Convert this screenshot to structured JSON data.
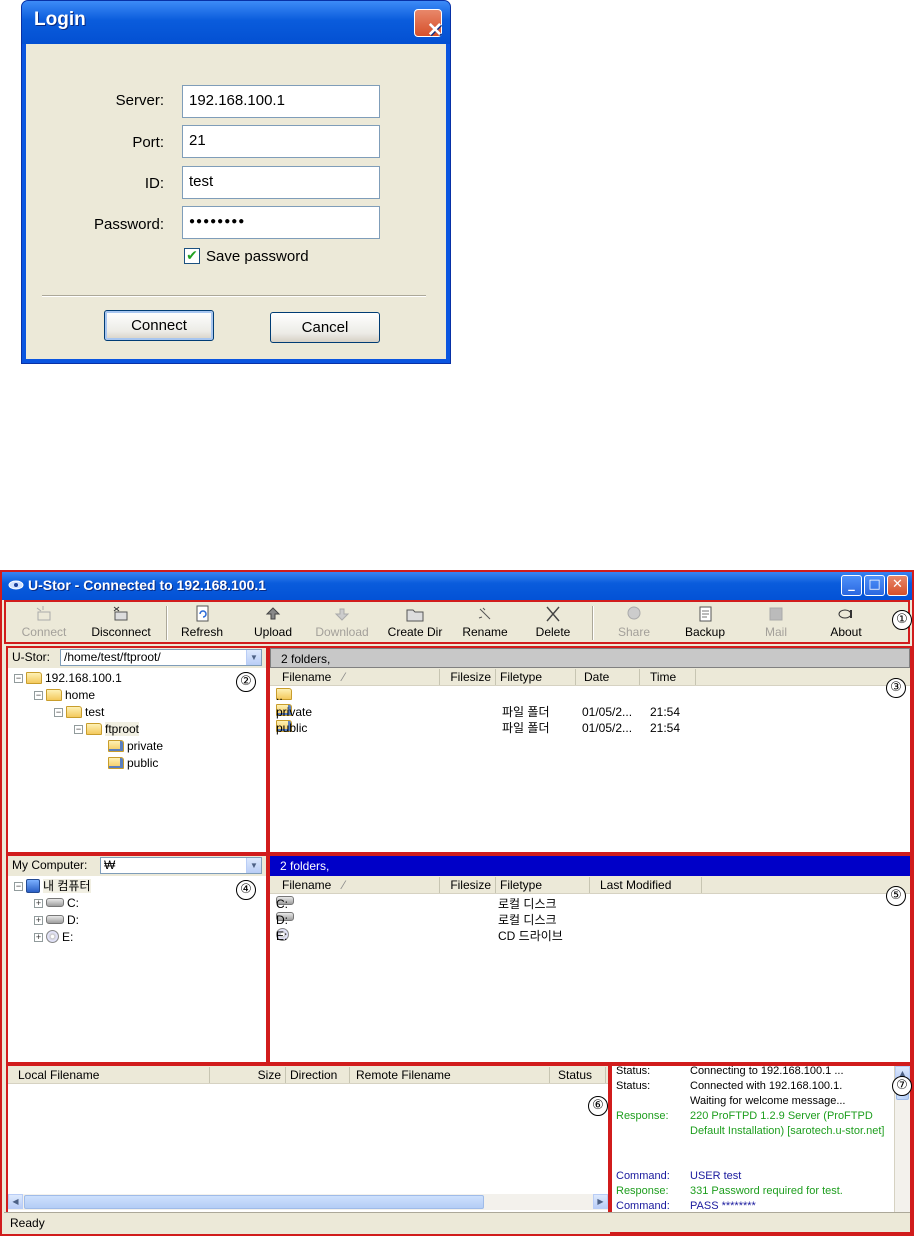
{
  "login": {
    "title": "Login",
    "close_glyph": "✕",
    "fields": [
      {
        "label": "Server:",
        "value": "192.168.100.1"
      },
      {
        "label": "Port:",
        "value": "21"
      },
      {
        "label": "ID:",
        "value": "test"
      },
      {
        "label": "Password:",
        "value": "●●●●●●●●"
      }
    ],
    "save_password": {
      "label": "Save password",
      "checked": true,
      "glyph": "✔"
    },
    "connect_label": "Connect",
    "cancel_label": "Cancel"
  },
  "app": {
    "title": "U-Stor - Connected to 192.168.100.1",
    "window_buttons": {
      "minimize": "_",
      "maximize": "□",
      "close": "✕"
    },
    "toolbar": [
      {
        "label": "Connect",
        "icon": "connect-icon",
        "enabled": false
      },
      {
        "label": "Disconnect",
        "icon": "disconnect-icon",
        "enabled": true
      },
      {
        "label": "Refresh",
        "icon": "refresh-icon",
        "enabled": true
      },
      {
        "label": "Upload",
        "icon": "upload-icon",
        "enabled": true
      },
      {
        "label": "Download",
        "icon": "download-icon",
        "enabled": false
      },
      {
        "label": "Create Dir",
        "icon": "create-dir-icon",
        "enabled": true
      },
      {
        "label": "Rename",
        "icon": "rename-icon",
        "enabled": true
      },
      {
        "label": "Delete",
        "icon": "delete-icon",
        "enabled": true
      },
      {
        "label": "Share",
        "icon": "share-icon",
        "enabled": false
      },
      {
        "label": "Backup",
        "icon": "backup-icon",
        "enabled": true
      },
      {
        "label": "Mail",
        "icon": "mail-icon",
        "enabled": false
      },
      {
        "label": "About",
        "icon": "about-icon",
        "enabled": true
      }
    ],
    "remote_tree": {
      "label": "U-Stor:",
      "path": "/home/test/ftproot/",
      "nodes": [
        {
          "name": "192.168.100.1",
          "toggle": "⊟"
        },
        {
          "name": "home",
          "toggle": "⊟"
        },
        {
          "name": "test",
          "toggle": "⊟"
        },
        {
          "name": "ftproot",
          "toggle": "⊟"
        },
        {
          "name": "private"
        },
        {
          "name": "public"
        }
      ]
    },
    "remote_list": {
      "summary": "2 folders,",
      "columns": [
        "Filename",
        "Filesize",
        "Filetype",
        "Date",
        "Time"
      ],
      "sort_glyph": "⁄",
      "rows": [
        {
          "name": "..",
          "size": "",
          "type": "",
          "date": "",
          "time": ""
        },
        {
          "name": "private",
          "size": "",
          "type": "파일 폴더",
          "date": "01/05/2...",
          "time": "21:54"
        },
        {
          "name": "public",
          "size": "",
          "type": "파일 폴더",
          "date": "01/05/2...",
          "time": "21:54"
        }
      ]
    },
    "local_tree": {
      "label": "My Computer:",
      "path": "₩",
      "nodes": [
        {
          "name": "내 컴퓨터",
          "toggle": "⊟"
        },
        {
          "name": "C:",
          "toggle": "⊞"
        },
        {
          "name": "D:",
          "toggle": "⊞"
        },
        {
          "name": "E:",
          "toggle": "⊞"
        }
      ]
    },
    "local_list": {
      "summary": "2 folders,",
      "columns": [
        "Filename",
        "Filesize",
        "Filetype",
        "Last Modified"
      ],
      "sort_glyph": "⁄",
      "rows": [
        {
          "name": "C:",
          "type": "로컬 디스크"
        },
        {
          "name": "D:",
          "type": "로컬 디스크"
        },
        {
          "name": "E:",
          "type": "CD 드라이브"
        }
      ]
    },
    "queue": {
      "columns": [
        "Local Filename",
        "Size",
        "Direction",
        "Remote Filename",
        "Status"
      ]
    },
    "log": {
      "colors": {
        "status": "#000000",
        "response": "#1e9e1e",
        "command": "#1a1a9e"
      },
      "entries": [
        {
          "kind": "Status:",
          "text": "Connecting to 192.168.100.1 ...",
          "style": "status"
        },
        {
          "kind": "Status:",
          "text": "Connected with 192.168.100.1.",
          "style": "status"
        },
        {
          "kind": "",
          "text": "Waiting for welcome message...",
          "style": "status"
        },
        {
          "kind": "Response:",
          "text": "220 ProFTPD 1.2.9 Server (ProFTPD Default Installation) [sarotech.u-stor.net]",
          "style": "response"
        },
        {
          "kind": "Command:",
          "text": "USER test",
          "style": "command"
        },
        {
          "kind": "Response:",
          "text": "331 Password required for test.",
          "style": "response"
        },
        {
          "kind": "Command:",
          "text": "PASS ********",
          "style": "command"
        }
      ]
    },
    "status_text": "Ready",
    "annotations": [
      "①",
      "②",
      "③",
      "④",
      "⑤",
      "⑥",
      "⑦"
    ],
    "colors": {
      "highlight_border": "#d11c1c",
      "active_strip": "#0000c8",
      "inactive_strip": "#c8c8c8"
    }
  }
}
